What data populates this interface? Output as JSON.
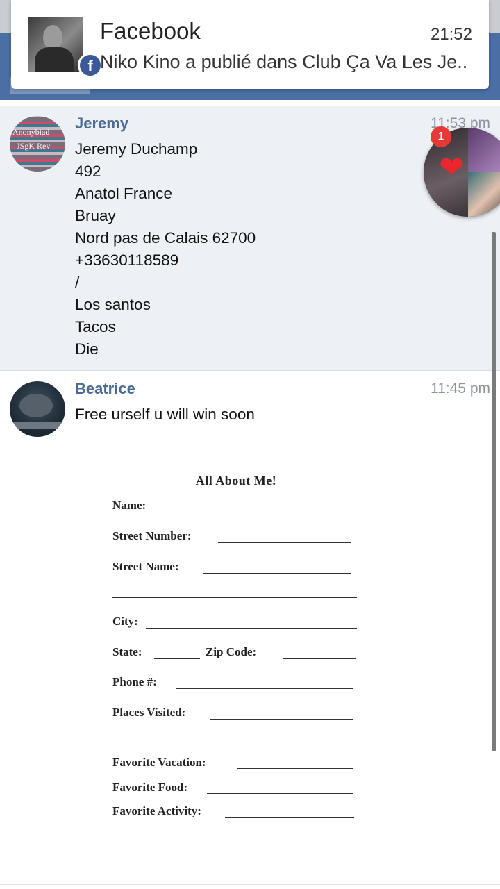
{
  "notification": {
    "app": "Facebook",
    "time": "21:52",
    "text": "Niko Kino a publié dans Club Ça Va Les Je..",
    "badge_icon": "facebook-f-icon"
  },
  "messages": [
    {
      "sender": "Jeremy",
      "time": "11:53 pm",
      "lines": [
        "Jeremy Duchamp",
        "492",
        "Anatol France",
        "Bruay",
        "Nord pas de Calais 62700",
        "+33630118589",
        "/",
        "Los santos",
        "Tacos",
        "Die"
      ],
      "avatar_text": [
        "Anonybiad",
        "JSgK Rev"
      ]
    },
    {
      "sender": "Beatrice",
      "time": "11:45 pm",
      "lines": [
        "Free urself u will win soon"
      ]
    }
  ],
  "worksheet": {
    "title": "All About Me!",
    "fields": [
      "Name:",
      "Street Number:",
      "Street Name:",
      "City:",
      "State:",
      "Zip Code:",
      "Phone #:",
      "Places Visited:",
      "Favorite Vacation:",
      "Favorite Food:",
      "Favorite Activity:"
    ]
  },
  "chathead": {
    "badge": "1"
  },
  "colors": {
    "facebook_blue": "#3b5998",
    "sender_name": "#4d6a93",
    "highlight_bg": "#edf0f5"
  }
}
